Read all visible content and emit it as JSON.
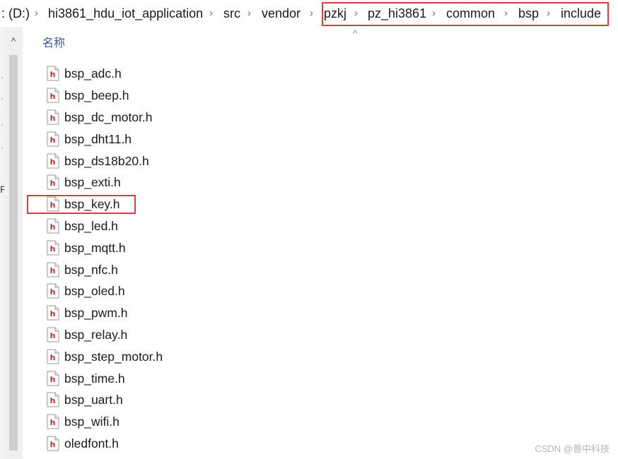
{
  "breadcrumb": {
    "items": [
      ": (D:)",
      "hi3861_hdu_iot_application",
      "src",
      "vendor",
      "pzkj",
      "pz_hi3861",
      "common",
      "bsp",
      "include"
    ],
    "separator": "›"
  },
  "file_list": {
    "column_header": "名称",
    "files": [
      "bsp_adc.h",
      "bsp_beep.h",
      "bsp_dc_motor.h",
      "bsp_dht11.h",
      "bsp_ds18b20.h",
      "bsp_exti.h",
      "bsp_key.h",
      "bsp_led.h",
      "bsp_mqtt.h",
      "bsp_nfc.h",
      "bsp_oled.h",
      "bsp_pwm.h",
      "bsp_relay.h",
      "bsp_step_motor.h",
      "bsp_time.h",
      "bsp_uart.h",
      "bsp_wifi.h",
      "oledfont.h"
    ],
    "file_icon": "c-header-file-icon",
    "highlighted_file": "bsp_key.h"
  },
  "left_pane_fragment": "F",
  "watermark": "CSDN @普中科技",
  "colors": {
    "highlight": "#e03a3a",
    "header_text": "#3b5998",
    "icon_letter": "#b03030"
  }
}
